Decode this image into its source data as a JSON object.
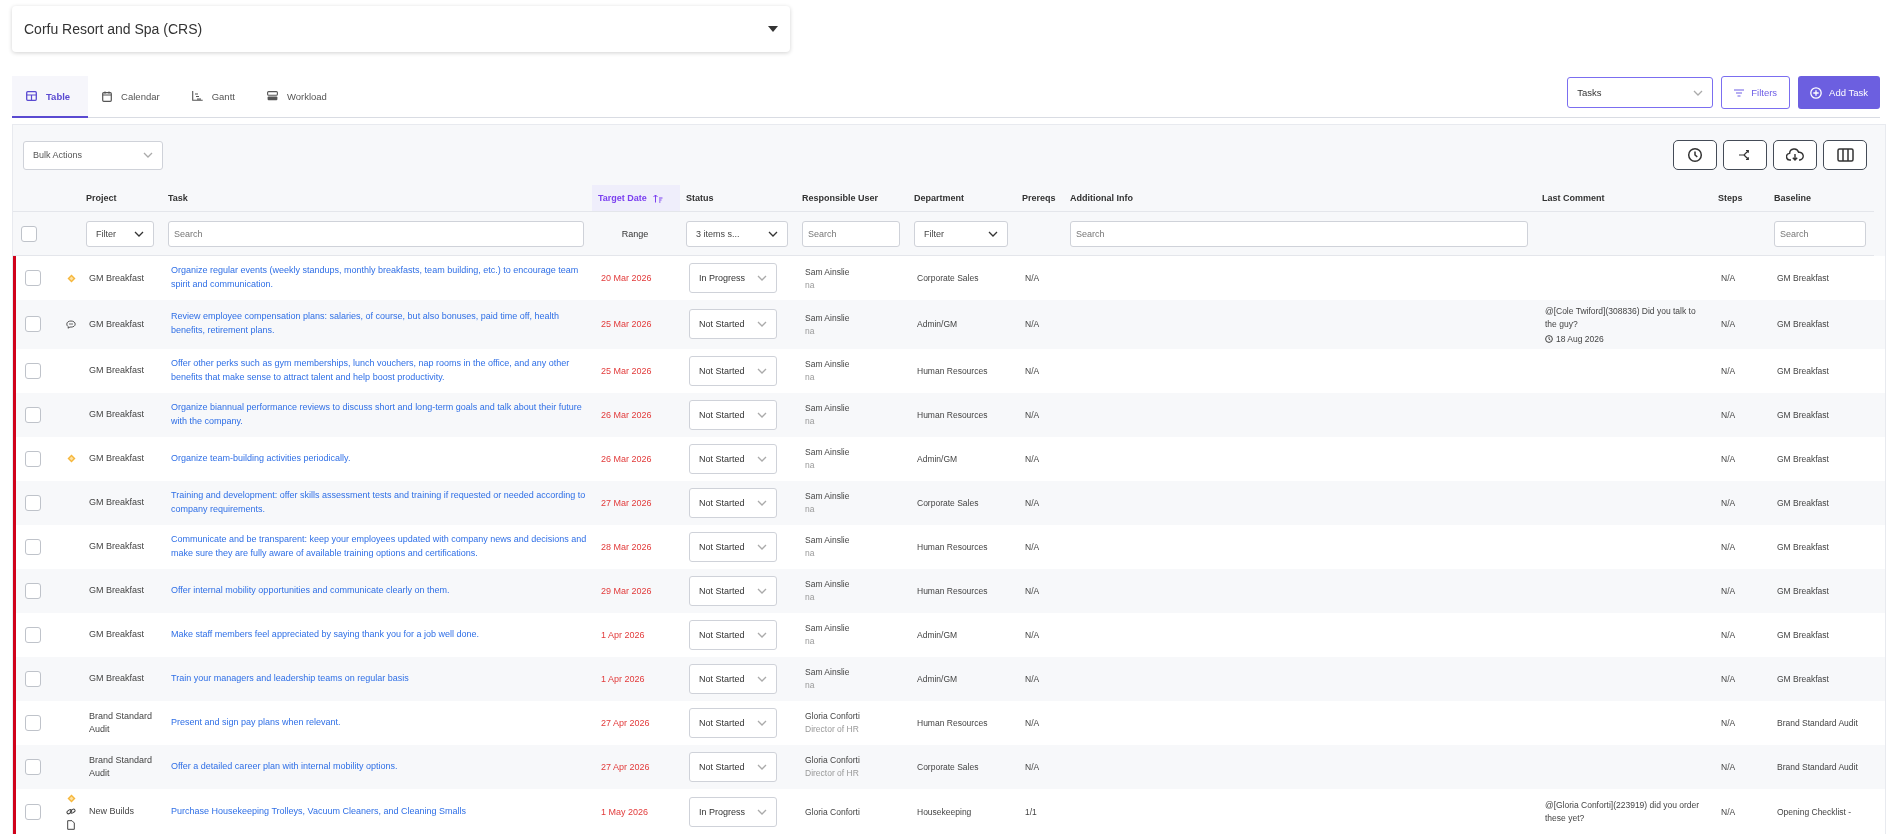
{
  "property_select": {
    "value": "Corfu Resort and Spa (CRS)"
  },
  "tabs": [
    {
      "label": "Table",
      "kind": "table",
      "selected": true
    },
    {
      "label": "Calendar",
      "kind": "calendar",
      "selected": false
    },
    {
      "label": "Gantt",
      "kind": "gantt",
      "selected": false
    },
    {
      "label": "Workload",
      "kind": "workload",
      "selected": false
    }
  ],
  "view_select": {
    "value": "Tasks"
  },
  "filters_button": {
    "label": "Filters"
  },
  "add_button": {
    "label": "Add Task"
  },
  "bulk_actions": {
    "value": "Bulk Actions"
  },
  "toolbar": [
    {
      "kind": "history"
    },
    {
      "kind": "share"
    },
    {
      "kind": "download"
    },
    {
      "kind": "columns"
    }
  ],
  "table": {
    "select_all_checked": false,
    "columns": [
      {
        "label": "Project",
        "sorted": false,
        "filter": {
          "kind": "select",
          "value": "Filter"
        }
      },
      {
        "label": "Task",
        "sorted": false,
        "filter": {
          "kind": "search",
          "placeholder": "Search"
        }
      },
      {
        "label": "Target Date",
        "sorted": true,
        "filter": {
          "kind": "range",
          "text": "Range"
        }
      },
      {
        "label": "Status",
        "sorted": false,
        "filter": {
          "kind": "select",
          "value": "3 items s..."
        }
      },
      {
        "label": "Responsible User",
        "sorted": false,
        "filter": {
          "kind": "search",
          "placeholder": "Search"
        }
      },
      {
        "label": "Department",
        "sorted": false,
        "filter": {
          "kind": "select",
          "value": "Filter"
        }
      },
      {
        "label": "Prereqs",
        "sorted": false,
        "filter": {
          "kind": "none"
        }
      },
      {
        "label": "Additional Info",
        "sorted": false,
        "filter": {
          "kind": "search",
          "placeholder": "Search"
        }
      },
      {
        "label": "Last Comment",
        "sorted": false,
        "filter": {
          "kind": "none"
        }
      },
      {
        "label": "Steps",
        "sorted": false,
        "filter": {
          "kind": "none"
        }
      },
      {
        "label": "Baseline",
        "sorted": false,
        "filter": {
          "kind": "search",
          "placeholder": "Search"
        }
      }
    ],
    "rows": [
      {
        "checked": false,
        "priority": true,
        "has_comment": false,
        "has_link": false,
        "has_file": false,
        "project": "GM Breakfast",
        "task": "Organize regular events (weekly standups, monthly breakfasts, team building, etc.) to encourage team spirit and communication.",
        "target_date": "20 Mar 2026",
        "overdue": true,
        "status": "In Progress",
        "user": "Sam Ainslie",
        "user_title": "na",
        "department": "Corporate Sales",
        "prereqs": "N/A",
        "steps": "N/A",
        "baseline": "GM Breakfast"
      },
      {
        "checked": false,
        "priority": false,
        "has_comment": true,
        "has_link": false,
        "has_file": false,
        "project": "GM Breakfast",
        "task": "Review employee compensation plans: salaries, of course, but also bonuses, paid time off, health benefits, retirement plans.",
        "target_date": "25 Mar 2026",
        "overdue": true,
        "status": "Not Started",
        "user": "Sam Ainslie",
        "user_title": "na",
        "department": "Admin/GM",
        "prereqs": "N/A",
        "last_comment": "@[Cole Twiford](308836) Did you talk to the guy?",
        "comment_date": "18 Aug 2026",
        "steps": "N/A",
        "baseline": "GM Breakfast"
      },
      {
        "checked": false,
        "priority": false,
        "has_comment": false,
        "has_link": false,
        "has_file": false,
        "project": "GM Breakfast",
        "task": "Offer other perks such as gym memberships, lunch vouchers, nap rooms in the office, and any other benefits that make sense to attract talent and help boost productivity.",
        "target_date": "25 Mar 2026",
        "overdue": true,
        "status": "Not Started",
        "user": "Sam Ainslie",
        "user_title": "na",
        "department": "Human Resources",
        "prereqs": "N/A",
        "steps": "N/A",
        "baseline": "GM Breakfast"
      },
      {
        "checked": false,
        "priority": false,
        "has_comment": false,
        "has_link": false,
        "has_file": false,
        "project": "GM Breakfast",
        "task": "Organize biannual performance reviews to discuss short and long-term goals and talk about their future with the company.",
        "target_date": "26 Mar 2026",
        "overdue": true,
        "status": "Not Started",
        "user": "Sam Ainslie",
        "user_title": "na",
        "department": "Human Resources",
        "prereqs": "N/A",
        "steps": "N/A",
        "baseline": "GM Breakfast"
      },
      {
        "checked": false,
        "priority": true,
        "has_comment": false,
        "has_link": false,
        "has_file": false,
        "project": "GM Breakfast",
        "task": "Organize team-building activities periodically.",
        "target_date": "26 Mar 2026",
        "overdue": true,
        "status": "Not Started",
        "user": "Sam Ainslie",
        "user_title": "na",
        "department": "Admin/GM",
        "prereqs": "N/A",
        "steps": "N/A",
        "baseline": "GM Breakfast"
      },
      {
        "checked": false,
        "priority": false,
        "has_comment": false,
        "has_link": false,
        "has_file": false,
        "project": "GM Breakfast",
        "task": "Training and development: offer skills assessment tests and training if requested or needed according to company requirements.",
        "target_date": "27 Mar 2026",
        "overdue": true,
        "status": "Not Started",
        "user": "Sam Ainslie",
        "user_title": "na",
        "department": "Corporate Sales",
        "prereqs": "N/A",
        "steps": "N/A",
        "baseline": "GM Breakfast"
      },
      {
        "checked": false,
        "priority": false,
        "has_comment": false,
        "has_link": false,
        "has_file": false,
        "project": "GM Breakfast",
        "task": "Communicate and be transparent: keep your employees updated with company news and decisions and make sure they are fully aware of available training options and certifications.",
        "target_date": "28 Mar 2026",
        "overdue": true,
        "status": "Not Started",
        "user": "Sam Ainslie",
        "user_title": "na",
        "department": "Human Resources",
        "prereqs": "N/A",
        "steps": "N/A",
        "baseline": "GM Breakfast"
      },
      {
        "checked": false,
        "priority": false,
        "has_comment": false,
        "has_link": false,
        "has_file": false,
        "project": "GM Breakfast",
        "task": "Offer internal mobility opportunities and communicate clearly on them.",
        "target_date": "29 Mar 2026",
        "overdue": true,
        "status": "Not Started",
        "user": "Sam Ainslie",
        "user_title": "na",
        "department": "Human Resources",
        "prereqs": "N/A",
        "steps": "N/A",
        "baseline": "GM Breakfast"
      },
      {
        "checked": false,
        "priority": false,
        "has_comment": false,
        "has_link": false,
        "has_file": false,
        "project": "GM Breakfast",
        "task": "Make staff members feel appreciated by saying thank you for a job well done.",
        "target_date": "1 Apr 2026",
        "overdue": true,
        "status": "Not Started",
        "user": "Sam Ainslie",
        "user_title": "na",
        "department": "Admin/GM",
        "prereqs": "N/A",
        "steps": "N/A",
        "baseline": "GM Breakfast"
      },
      {
        "checked": false,
        "priority": false,
        "has_comment": false,
        "has_link": false,
        "has_file": false,
        "project": "GM Breakfast",
        "task": "Train your managers and leadership teams on regular basis",
        "target_date": "1 Apr 2026",
        "overdue": true,
        "status": "Not Started",
        "user": "Sam Ainslie",
        "user_title": "na",
        "department": "Admin/GM",
        "prereqs": "N/A",
        "steps": "N/A",
        "baseline": "GM Breakfast"
      },
      {
        "checked": false,
        "priority": false,
        "has_comment": false,
        "has_link": false,
        "has_file": false,
        "project": "Brand Standard Audit",
        "task": "Present and sign pay plans when relevant.",
        "target_date": "27 Apr 2026",
        "overdue": true,
        "status": "Not Started",
        "user": "Gloria Conforti",
        "user_title": "Director of HR",
        "department": "Human Resources",
        "prereqs": "N/A",
        "steps": "N/A",
        "baseline": "Brand Standard Audit"
      },
      {
        "checked": false,
        "priority": false,
        "has_comment": false,
        "has_link": false,
        "has_file": false,
        "project": "Brand Standard Audit",
        "task": "Offer a detailed career plan with internal mobility options.",
        "target_date": "27 Apr 2026",
        "overdue": true,
        "status": "Not Started",
        "user": "Gloria Conforti",
        "user_title": "Director of HR",
        "department": "Corporate Sales",
        "prereqs": "N/A",
        "steps": "N/A",
        "baseline": "Brand Standard Audit"
      },
      {
        "checked": false,
        "priority": true,
        "has_comment": false,
        "has_link": true,
        "has_file": true,
        "project": "New Builds",
        "task": "Purchase Housekeeping Trolleys, Vacuum Cleaners, and Cleaning Smalls",
        "target_date": "1 May 2026",
        "overdue": true,
        "status": "In Progress",
        "user": "Gloria Conforti",
        "department": "Housekeeping",
        "prereqs": "1/1",
        "last_comment": "@[Gloria Conforti](223919) did you order these yet?",
        "steps": "N/A",
        "baseline": "Opening Checklist -"
      }
    ]
  }
}
